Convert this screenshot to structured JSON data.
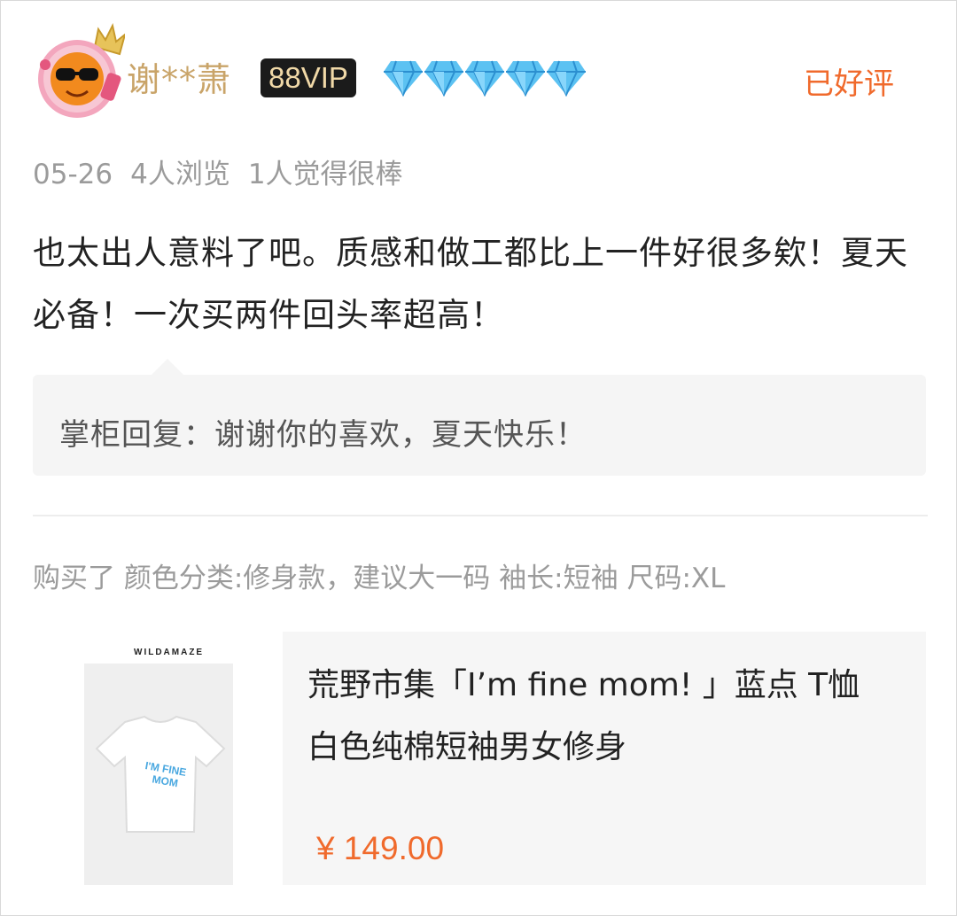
{
  "header": {
    "username": "谢**萧",
    "vip_label": "88VIP",
    "rating_status": "已好评",
    "diamond_count": 5,
    "colors": {
      "username": "#c9a469",
      "accent": "#f06a2c",
      "diamond": "#4fb8ee"
    }
  },
  "meta": {
    "date": "05-26",
    "views": "4人浏览",
    "likes": "1人觉得很棒"
  },
  "review": {
    "text": "也太出人意料了吧。质感和做工都比上一件好很多欸！夏天必备！一次买两件回头率超高！"
  },
  "reply": {
    "text": "掌柜回复：谢谢你的喜欢，夏天快乐！"
  },
  "purchase": {
    "text": "购买了 颜色分类:修身款，建议大一码 袖长:短袖 尺码:XL"
  },
  "product": {
    "image_brand": "WILDAMAZE",
    "image_shirt_text_line1": "I'M FINE",
    "image_shirt_text_line2": "MOM",
    "title": "荒野市集「I’m fine mom! 」蓝点 T恤 白色纯棉短袖男女修身",
    "price": "¥ 149.00"
  }
}
